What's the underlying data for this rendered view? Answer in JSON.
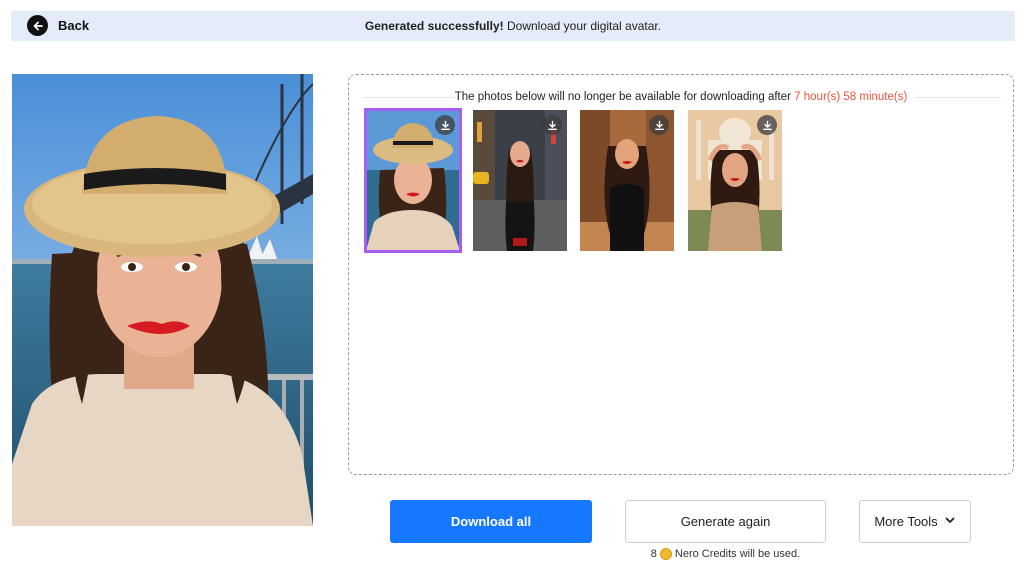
{
  "header": {
    "back_label": "Back",
    "banner_strong": "Generated successfully!",
    "banner_text": " Download your digital avatar."
  },
  "gallery": {
    "notice_prefix": "The photos below will no longer be available for downloading after ",
    "notice_timer": "7 hour(s) 58 minute(s)",
    "selected_index": 0,
    "thumbnails": [
      {
        "name": "hat-harbor-selfie",
        "download_icon": "download-icon"
      },
      {
        "name": "city-street-night",
        "download_icon": "download-icon"
      },
      {
        "name": "desert-ruins-sunset",
        "download_icon": "download-icon"
      },
      {
        "name": "taj-mahal-selfie",
        "download_icon": "download-icon"
      }
    ]
  },
  "actions": {
    "download_all": "Download all",
    "generate_again": "Generate again",
    "more_tools": "More Tools",
    "credits_count": "8",
    "credits_text": "Nero Credits will be used."
  },
  "colors": {
    "accent": "#1677ff",
    "selected_outline": "#a65ef0",
    "timer": "#e4553f",
    "banner_bg": "#e4ecfa"
  }
}
